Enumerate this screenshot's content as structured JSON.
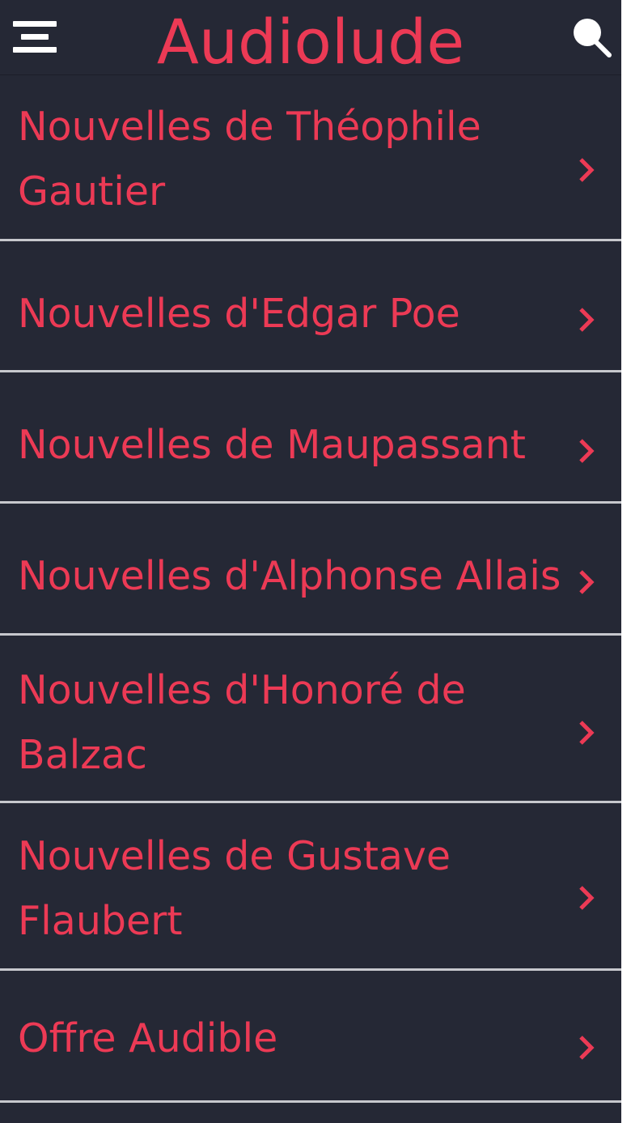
{
  "header": {
    "title": "Audiolude",
    "menu_icon": "hamburger-menu-icon",
    "search_icon": "search-icon"
  },
  "colors": {
    "background": "#252835",
    "accent": "#ec3a55",
    "divider": "#c7c8cd"
  },
  "list": {
    "items": [
      {
        "label": "Nouvelles de Théophile Gautier"
      },
      {
        "label": "Nouvelles d'Edgar Poe"
      },
      {
        "label": "Nouvelles de Maupassant"
      },
      {
        "label": "Nouvelles d'Alphonse Allais"
      },
      {
        "label": "Nouvelles d'Honoré de Balzac"
      },
      {
        "label": "Nouvelles de Gustave Flaubert"
      },
      {
        "label": "Offre Audible"
      }
    ],
    "chevron_icon": "chevron-right-icon"
  }
}
